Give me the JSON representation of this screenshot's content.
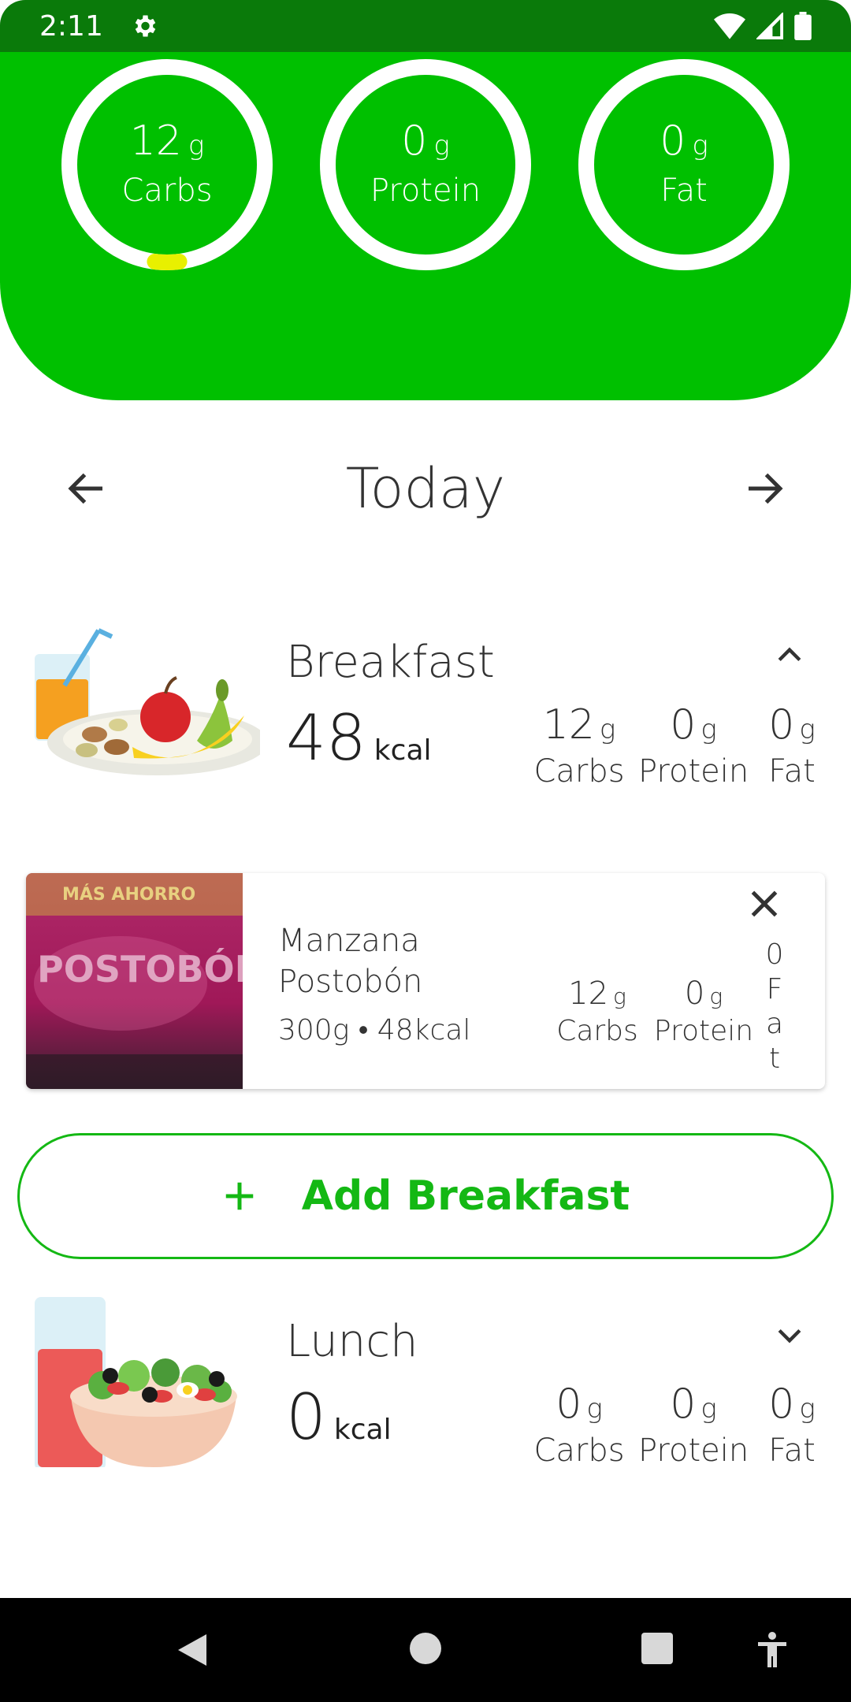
{
  "status_bar": {
    "time": "2:11"
  },
  "macros": [
    {
      "value": "12",
      "unit": "g",
      "label": "Carbs",
      "progress": 0.04
    },
    {
      "value": "0",
      "unit": "g",
      "label": "Protein",
      "progress": 0
    },
    {
      "value": "0",
      "unit": "g",
      "label": "Fat",
      "progress": 0
    }
  ],
  "date_nav": {
    "title": "Today"
  },
  "breakfast": {
    "title": "Breakfast",
    "kcal": "48",
    "kcal_unit": "kcal",
    "carbs": {
      "value": "12",
      "unit": "g",
      "label": "Carbs"
    },
    "protein": {
      "value": "0",
      "unit": "g",
      "label": "Protein"
    },
    "fat": {
      "value": "0",
      "unit": "g",
      "label": "Fat"
    }
  },
  "food_item": {
    "name": "Manzana Postobón",
    "meta": "300g • 48kcal",
    "photo_text_top": "MÁS AHORRO",
    "photo_text_brand": "POSTOBÓN",
    "carbs": {
      "value": "12",
      "unit": "g",
      "label": "Carbs"
    },
    "protein": {
      "value": "0",
      "unit": "g",
      "label": "Protein"
    },
    "fat": {
      "value": "0",
      "label": "Fat"
    }
  },
  "add_button": {
    "label": "Add Breakfast"
  },
  "lunch": {
    "title": "Lunch",
    "kcal": "0",
    "kcal_unit": "kcal",
    "carbs": {
      "value": "0",
      "unit": "g",
      "label": "Carbs"
    },
    "protein": {
      "value": "0",
      "unit": "g",
      "label": "Protein"
    },
    "fat": {
      "value": "0",
      "unit": "g",
      "label": "Fat"
    }
  },
  "colors": {
    "header_green": "#00c000",
    "status_green": "#0a7a0a",
    "accent_green": "#14b814",
    "progress_yellow": "#e8f000"
  }
}
